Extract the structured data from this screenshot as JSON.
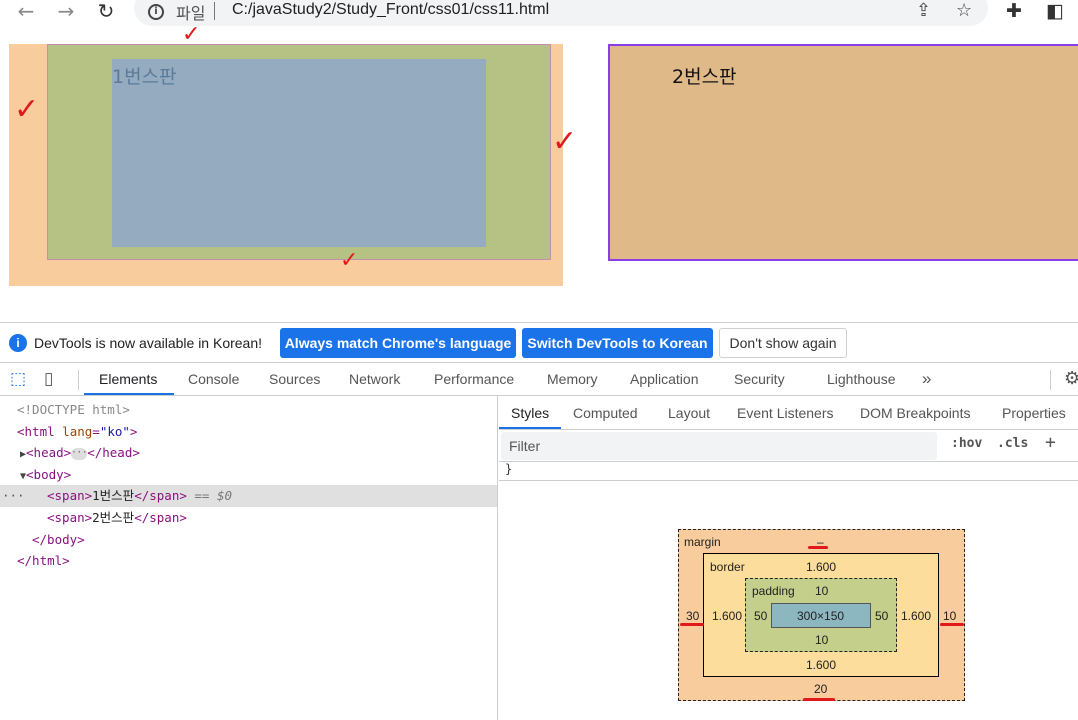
{
  "browser": {
    "scheme_label": "파일",
    "url": "C:/javaStudy2/Study_Front/css01/css11.html"
  },
  "page": {
    "box1_text": "1번스판",
    "box2_text": "2번스판",
    "colors": {
      "margin": "#f9cc9d",
      "border": "#b6c283",
      "content": "#94abc0",
      "box2": "#dfb988",
      "box2_border": "#8a3ee8"
    }
  },
  "infobar": {
    "message": "DevTools is now available in Korean!",
    "btn_match": "Always match Chrome's language",
    "btn_switch": "Switch DevTools to Korean",
    "btn_dismiss": "Don't show again"
  },
  "devtools": {
    "tabs": [
      "Elements",
      "Console",
      "Sources",
      "Network",
      "Performance",
      "Memory",
      "Application",
      "Security",
      "Lighthouse"
    ],
    "more": "»",
    "active_tab": "Elements"
  },
  "dom": {
    "doctype": "<!DOCTYPE html>",
    "html_open": "<html",
    "html_attr": "lang",
    "html_attr_val": "\"ko\"",
    "head_open": "<head>",
    "head_close": "</head>",
    "body_open": "<body>",
    "span1_open": "<span>",
    "span1_text": "1번스판",
    "span1_close": "</span>",
    "selected_marker": "== $0",
    "span2_open": "<span>",
    "span2_text": "2번스판",
    "span2_close": "</span>",
    "body_close": "</body>",
    "html_close": "</html>"
  },
  "styles": {
    "subtabs": [
      "Styles",
      "Computed",
      "Layout",
      "Event Listeners",
      "DOM Breakpoints",
      "Properties"
    ],
    "filter_placeholder": "Filter",
    "hov": ":hov",
    "cls": ".cls",
    "plus": "+",
    "brace": "}"
  },
  "box_model": {
    "margin_label": "margin",
    "margin_top": "–",
    "margin_left": "30",
    "margin_right": "10",
    "margin_bottom": "20",
    "border_label": "border",
    "border_top": "1.600",
    "border_left": "1.600",
    "border_right": "1.600",
    "border_bottom": "1.600",
    "padding_label": "padding",
    "padding_top": "10",
    "padding_left": "50",
    "padding_right": "50",
    "padding_bottom": "10",
    "content_size": "300×150"
  }
}
